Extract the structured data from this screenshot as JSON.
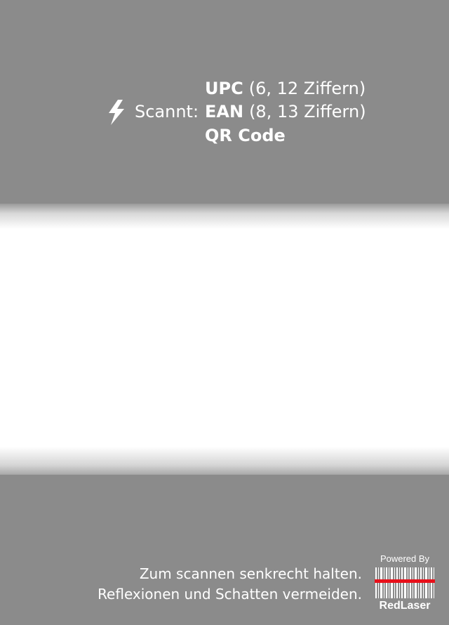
{
  "scanner": {
    "icon": "lightning-bolt-icon",
    "label": "Scannt:",
    "formats": [
      {
        "name": "UPC",
        "detail": "(6, 12 Ziffern)"
      },
      {
        "name": "EAN",
        "detail": "(8, 13 Ziffern)"
      },
      {
        "name": "QR Code",
        "detail": ""
      }
    ]
  },
  "hints": {
    "line1": "Zum scannen senkrecht halten.",
    "line2": "Reflexionen und Schatten vermeiden."
  },
  "logo": {
    "powered_by": "Powered By",
    "brand": "RedLaser",
    "laser_color": "#e8101a"
  },
  "colors": {
    "panel": "#8b8b8b",
    "scan_window": "#ffffff",
    "text": "#ffffff"
  }
}
